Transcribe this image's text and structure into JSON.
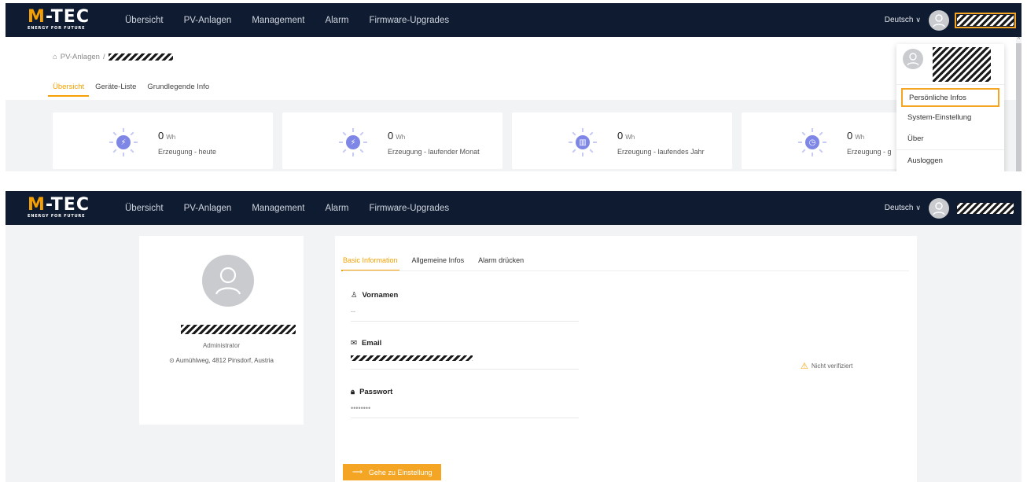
{
  "brand": {
    "logo_main_accent": "M",
    "logo_main_rest": "-TEC",
    "logo_sub": "ENERGY FOR FUTURE"
  },
  "nav": [
    "Übersicht",
    "PV-Anlagen",
    "Management",
    "Alarm",
    "Firmware-Upgrades"
  ],
  "language": "Deutsch",
  "colors": {
    "header": "#0f1b30",
    "accent": "#f5a000",
    "highlight": "#f5a524",
    "icon": "#7e86e6"
  },
  "plant_view": {
    "breadcrumb_root": "PV-Anlagen",
    "breadcrumb_sep": "/",
    "tabs": [
      "Übersicht",
      "Geräte-Liste",
      "Grundlegende Info"
    ],
    "cards": [
      {
        "value": "0",
        "unit": "Wh",
        "label": "Erzeugung - heute",
        "icon": "lightning-icon"
      },
      {
        "value": "0",
        "unit": "Wh",
        "label": "Erzeugung - laufender Monat",
        "icon": "lightning-icon"
      },
      {
        "value": "0",
        "unit": "Wh",
        "label": "Erzeugung - laufendes Jahr",
        "icon": "bar-chart-icon"
      },
      {
        "value": "0",
        "unit": "Wh",
        "label": "Erzeugung - g",
        "icon": "clock-icon"
      }
    ],
    "user_menu": [
      "Persönliche Infos",
      "System-Einstellung",
      "Über",
      "Ausloggen"
    ]
  },
  "profile": {
    "role": "Administrator",
    "location": "Aumühlweg, 4812 Pinsdorf, Austria",
    "tabs": [
      "Basic Information",
      "Allgemeine Infos",
      "Alarm drücken"
    ],
    "fields": {
      "first_name_label": "Vornamen",
      "first_name_value": "--",
      "email_label": "Email",
      "email_status": "Nicht verifiziert",
      "password_label": "Passwort",
      "password_value": "••••••••"
    },
    "settings_button": "Gehe zu Einstellung"
  }
}
